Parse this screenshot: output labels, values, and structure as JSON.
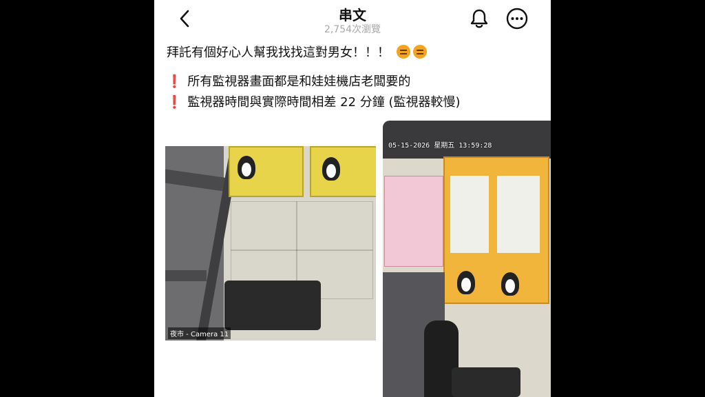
{
  "header": {
    "title": "串文",
    "views": "2,754次瀏覽"
  },
  "post": {
    "line1": "拜託有個好心人幫我找找這對男女！！！",
    "line2": "所有監視器畫面都是和娃娃機店老闆要的",
    "line3": "監視器時間與實際時間相差 22 分鐘 (監視器較慢)",
    "bullet_icon": "red-exclamation-icon",
    "emoji_icon": "tired-face-emoji"
  },
  "images": [
    {
      "caption": "夜市 - Camera 11"
    },
    {
      "timestamp": "05-15-2026 星期五 13:59:28"
    }
  ],
  "colors": {
    "background": "#000000",
    "panel": "#ffffff",
    "accent_red": "#e0312a",
    "claw_machine_yellow": "#e7d44a"
  }
}
